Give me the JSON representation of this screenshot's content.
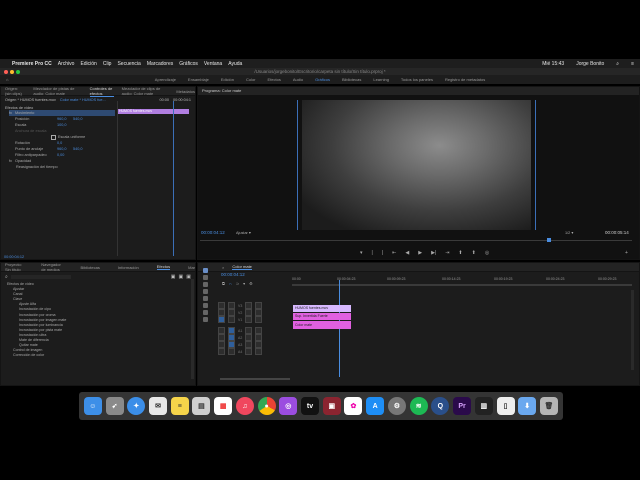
{
  "menubar": {
    "app": "Premiere Pro CC",
    "items": [
      "Archivo",
      "Edición",
      "Clip",
      "Secuencia",
      "Marcadores",
      "Gráficos",
      "Ventana",
      "Ayuda"
    ],
    "clock": "Mié 15:43",
    "user": "Jorge Bonito"
  },
  "window_title": "/Usuarios/jorgebonito/Escritorio/carpeta sin título/Sin título.prproj *",
  "workspaces": {
    "items": [
      "Aprendizaje",
      "Ensamblaje",
      "Edición",
      "Color",
      "Efectos",
      "Audio",
      "Gráficos",
      "Bibliotecas",
      "Learning",
      "Todos los paneles",
      "Registro de metadatos"
    ],
    "active": "Gráficos"
  },
  "effect_controls": {
    "tabs": [
      "Origen: (sin clips)",
      "Mezclador de pistas de audio: Color mate",
      "Controles de efectos",
      "Mezclador de clips de audio: Color mate",
      "Metadatos"
    ],
    "selected_tab": "Controles de efectos",
    "source": "Origen * HUMOS fuentes.mov",
    "seq": "Color mate * HUMOS fue...",
    "timecode_head": "00:00",
    "timecode_head_right": "00:00:04:1",
    "clip_label": "HUMOS fuentes.mov",
    "section": "Efectos de vídeo",
    "rows": [
      {
        "name": "Movimiento",
        "value": ""
      },
      {
        "name": "Posición",
        "value": "960,0",
        "value2": "540,0"
      },
      {
        "name": "Escala",
        "value": "100,0",
        "value2": ""
      },
      {
        "name": "Anchura de escala",
        "value": "",
        "value2": ""
      },
      {
        "name": "",
        "value": "Escala uniforme",
        "value2": ""
      },
      {
        "name": "Rotación",
        "value": "0,0",
        "value2": ""
      },
      {
        "name": "Punto de anclaje",
        "value": "960,0",
        "value2": "540,0"
      },
      {
        "name": "Filtro antiparpadeo",
        "value": "0,00",
        "value2": ""
      },
      {
        "name": "Opacidad",
        "value": "",
        "value2": ""
      },
      {
        "name": "Reasignación del tiempo",
        "value": "",
        "value2": ""
      }
    ],
    "footer_timecode": "00:00:04:12"
  },
  "program": {
    "title": "Programa: Color mate",
    "timecode": "00:00:04:12",
    "fit": "Ajustar",
    "quality": "1/2",
    "duration": "00:00:05:14"
  },
  "project": {
    "tabs": [
      "Proyecto: Sin título",
      "Navegador de medios",
      "Bibliotecas",
      "Información",
      "Efectos",
      "Mar"
    ],
    "selected_tab": "Efectos",
    "tree": [
      "Efectos de vídeo",
      "Ajustar",
      "Canal",
      "Clave",
      "Ajuste Alfa",
      "Incrustación de cipo",
      "Incrustación por croma",
      "Incrustación por imagen mate",
      "Incrustación por luminancia",
      "Incrustación por pista mate",
      "Incrustación ultra",
      "Mate de diferencia",
      "Quitar mate",
      "Control de imagen",
      "Corrección de color"
    ]
  },
  "timeline": {
    "title": "Color mate",
    "timecode": "00:00:04:12",
    "ruler": [
      "00:00",
      "00:00:04:23",
      "00:00:09:23",
      "00:00:14:23",
      "00:00:19:23",
      "00:00:24:23",
      "00:00:29:23"
    ],
    "video_tracks": [
      "V3",
      "V2",
      "V1"
    ],
    "audio_tracks": [
      "A1",
      "A2",
      "A3",
      "A4"
    ],
    "clips": [
      {
        "label": "HUMOS fuentes.mov",
        "color": "#d7b8ff"
      },
      {
        "label": "Sup. Invertida Fuerte",
        "color": "#e060e0"
      },
      {
        "label": "Color mate",
        "color": "#e060e0"
      }
    ]
  },
  "dock": {
    "items": [
      "finder-icon",
      "launchpad-icon",
      "safari-icon",
      "mail-icon",
      "notes-icon",
      "preview-icon",
      "calendar-icon",
      "music-icon",
      "chrome-icon",
      "podcasts-icon",
      "appletv-icon",
      "photo-booth-icon",
      "photos-icon",
      "appstore-icon",
      "system-preferences-icon",
      "spotify-icon",
      "quicktime-icon",
      "premiere-icon",
      "piano-icon",
      "document-icon",
      "downloads-icon",
      "trash-icon"
    ],
    "premiere_label": "Pr"
  }
}
